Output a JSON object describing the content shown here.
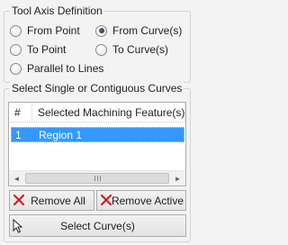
{
  "tool_axis": {
    "title": "Tool Axis Definition",
    "options": [
      {
        "label": "From Point",
        "checked": false
      },
      {
        "label": "From Curve(s)",
        "checked": true
      },
      {
        "label": "To Point",
        "checked": false
      },
      {
        "label": "To Curve(s)",
        "checked": false
      },
      {
        "label": "Parallel to Lines",
        "checked": false
      }
    ]
  },
  "curves": {
    "title": "Select Single or Contiguous Curves",
    "columns": [
      "#",
      "Selected Machining Feature(s)"
    ],
    "rows": [
      {
        "num": "1",
        "feature": "Region 1",
        "selected": true
      }
    ],
    "scroll_left_glyph": "◄",
    "scroll_right_glyph": "►"
  },
  "buttons": {
    "remove_all": "Remove All",
    "remove_active": "Remove Active",
    "select_curves": "Select Curve(s)"
  },
  "icons": {
    "remove": "red-x-icon",
    "select": "cursor-arrow-icon"
  },
  "colors": {
    "selection": "#3399ff",
    "remove_icon": "#cc2222"
  }
}
